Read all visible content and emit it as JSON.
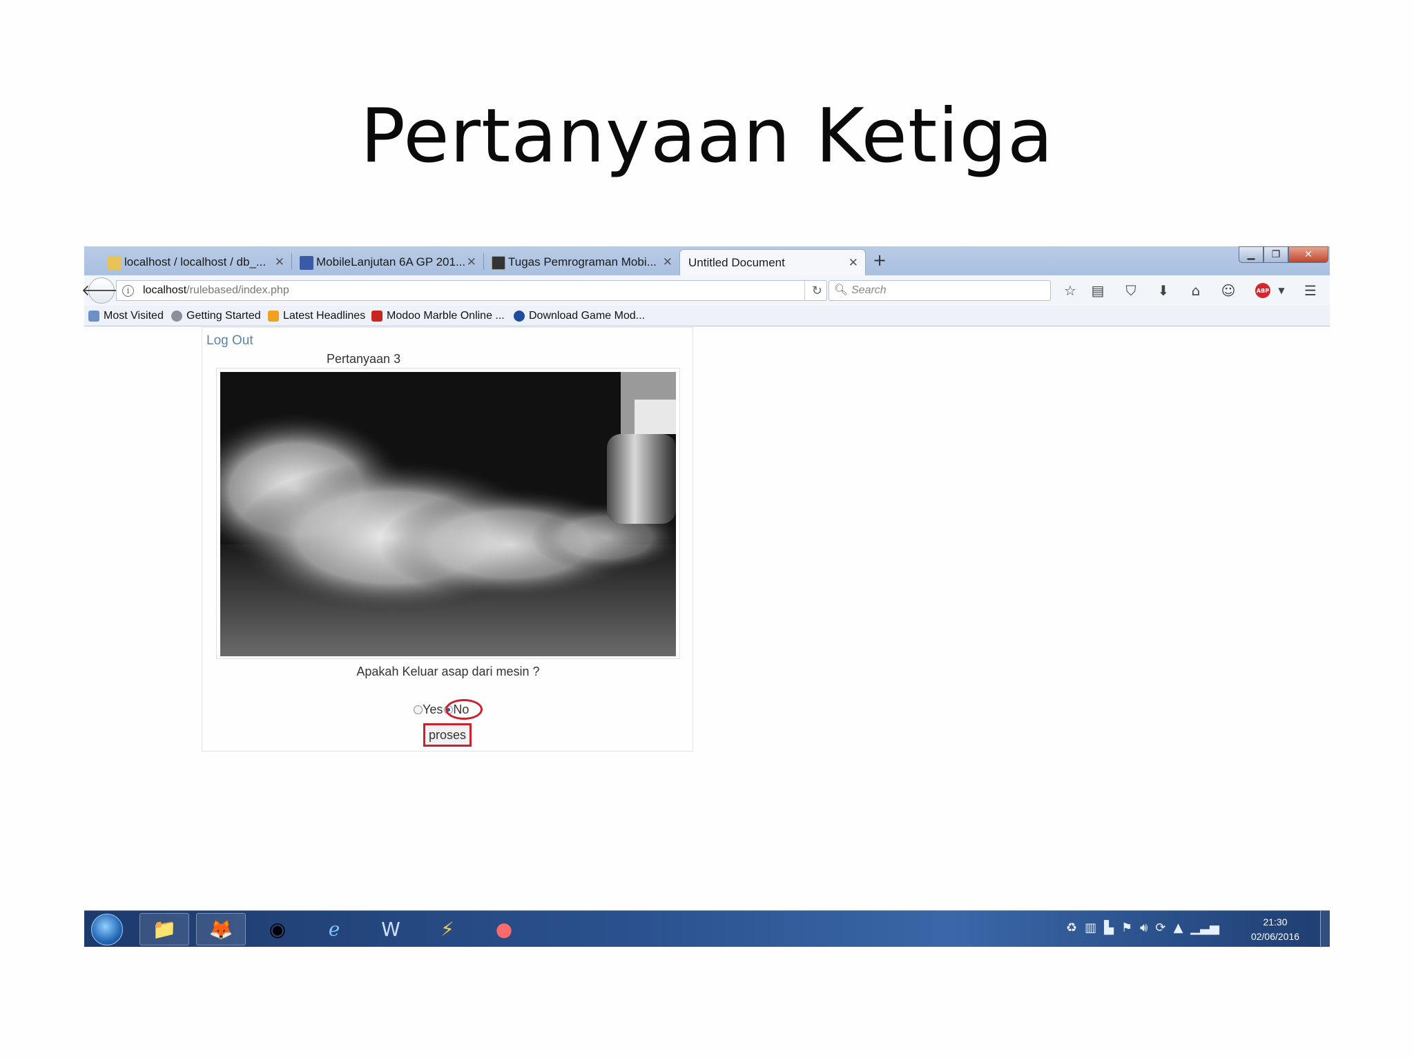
{
  "slide": {
    "title": "Pertanyaan Ketiga"
  },
  "browser": {
    "tabs": [
      {
        "label": "localhost / localhost / db_...",
        "active": false
      },
      {
        "label": "MobileLanjutan 6A GP 201...",
        "active": false
      },
      {
        "label": "Tugas Pemrograman Mobi...",
        "active": false
      },
      {
        "label": "Untitled Document",
        "active": true
      }
    ],
    "address": {
      "host": "localhost",
      "path": "/rulebased/index.php"
    },
    "search": {
      "placeholder": "Search"
    },
    "bookmarks": [
      "Most Visited",
      "Getting Started",
      "Latest Headlines",
      "Modoo Marble Online ...",
      "Download Game Mod..."
    ]
  },
  "page": {
    "logout": "Log Out",
    "heading": "Pertanyaan 3",
    "question": "Apakah Keluar asap dari mesin ?",
    "options": {
      "yes": "Yes",
      "no": "No",
      "selected": "No"
    },
    "submit": "proses"
  },
  "taskbar": {
    "apps": [
      "windows-explorer",
      "firefox",
      "chrome",
      "internet-explorer",
      "word",
      "winamp",
      "bluestacks"
    ],
    "time": "21:30",
    "date": "02/06/2016"
  },
  "colors": {
    "highlight": "#c9212d",
    "link": "#5b85a8",
    "taskbar": "#2b528f"
  }
}
